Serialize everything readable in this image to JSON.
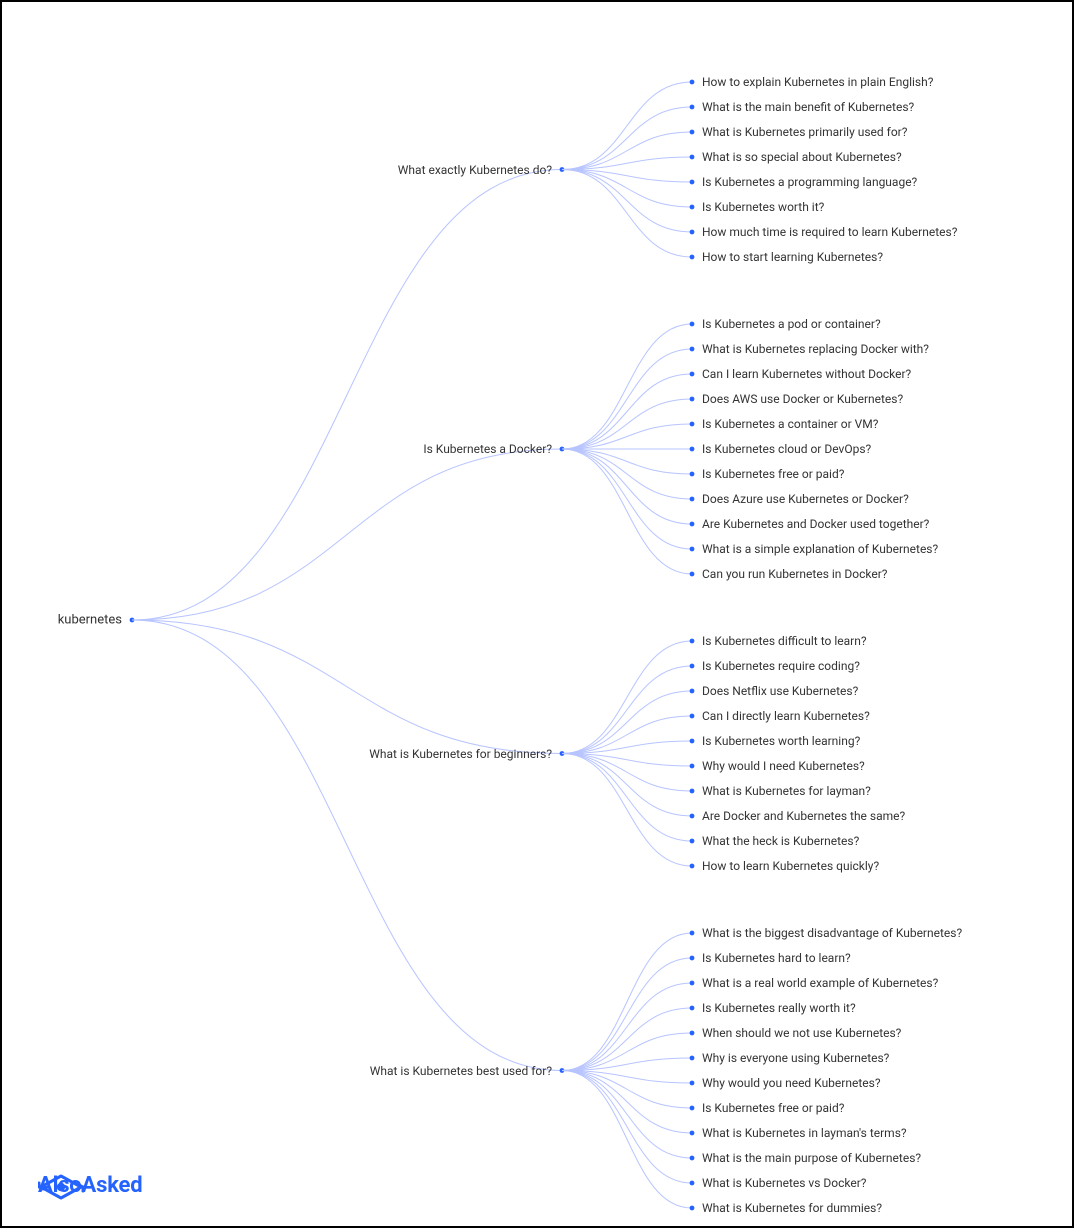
{
  "brand": {
    "name": "AlsoAsked"
  },
  "colors": {
    "brand": "#2563ff",
    "line": "#b7c4ff"
  },
  "tree": {
    "root": "kubernetes",
    "branches": [
      {
        "label": "What exactly Kubernetes do?",
        "children": [
          "How to explain Kubernetes in plain English?",
          "What is the main benefit of Kubernetes?",
          "What is Kubernetes primarily used for?",
          "What is so special about Kubernetes?",
          "Is Kubernetes a programming language?",
          "Is Kubernetes worth it?",
          "How much time is required to learn Kubernetes?",
          "How to start learning Kubernetes?"
        ]
      },
      {
        "label": "Is Kubernetes a Docker?",
        "children": [
          "Is Kubernetes a pod or container?",
          "What is Kubernetes replacing Docker with?",
          "Can I learn Kubernetes without Docker?",
          "Does AWS use Docker or Kubernetes?",
          "Is Kubernetes a container or VM?",
          "Is Kubernetes cloud or DevOps?",
          "Is Kubernetes free or paid?",
          "Does Azure use Kubernetes or Docker?",
          "Are Kubernetes and Docker used together?",
          "What is a simple explanation of Kubernetes?",
          "Can you run Kubernetes in Docker?"
        ]
      },
      {
        "label": "What is Kubernetes for beginners?",
        "children": [
          "Is Kubernetes difficult to learn?",
          "Is Kubernetes require coding?",
          "Does Netflix use Kubernetes?",
          "Can I directly learn Kubernetes?",
          "Is Kubernetes worth learning?",
          "Why would I need Kubernetes?",
          "What is Kubernetes for layman?",
          "Are Docker and Kubernetes the same?",
          "What the heck is Kubernetes?",
          "How to learn Kubernetes quickly?"
        ]
      },
      {
        "label": "What is Kubernetes best used for?",
        "children": [
          "What is the biggest disadvantage of Kubernetes?",
          "Is Kubernetes hard to learn?",
          "What is a real world example of Kubernetes?",
          "Is Kubernetes really worth it?",
          "When should we not use Kubernetes?",
          "Why is everyone using Kubernetes?",
          "Why would you need Kubernetes?",
          "Is Kubernetes free or paid?",
          "What is Kubernetes in layman's terms?",
          "What is the main purpose of Kubernetes?",
          "What is Kubernetes vs Docker?",
          "What is Kubernetes for dummies?"
        ]
      }
    ]
  }
}
